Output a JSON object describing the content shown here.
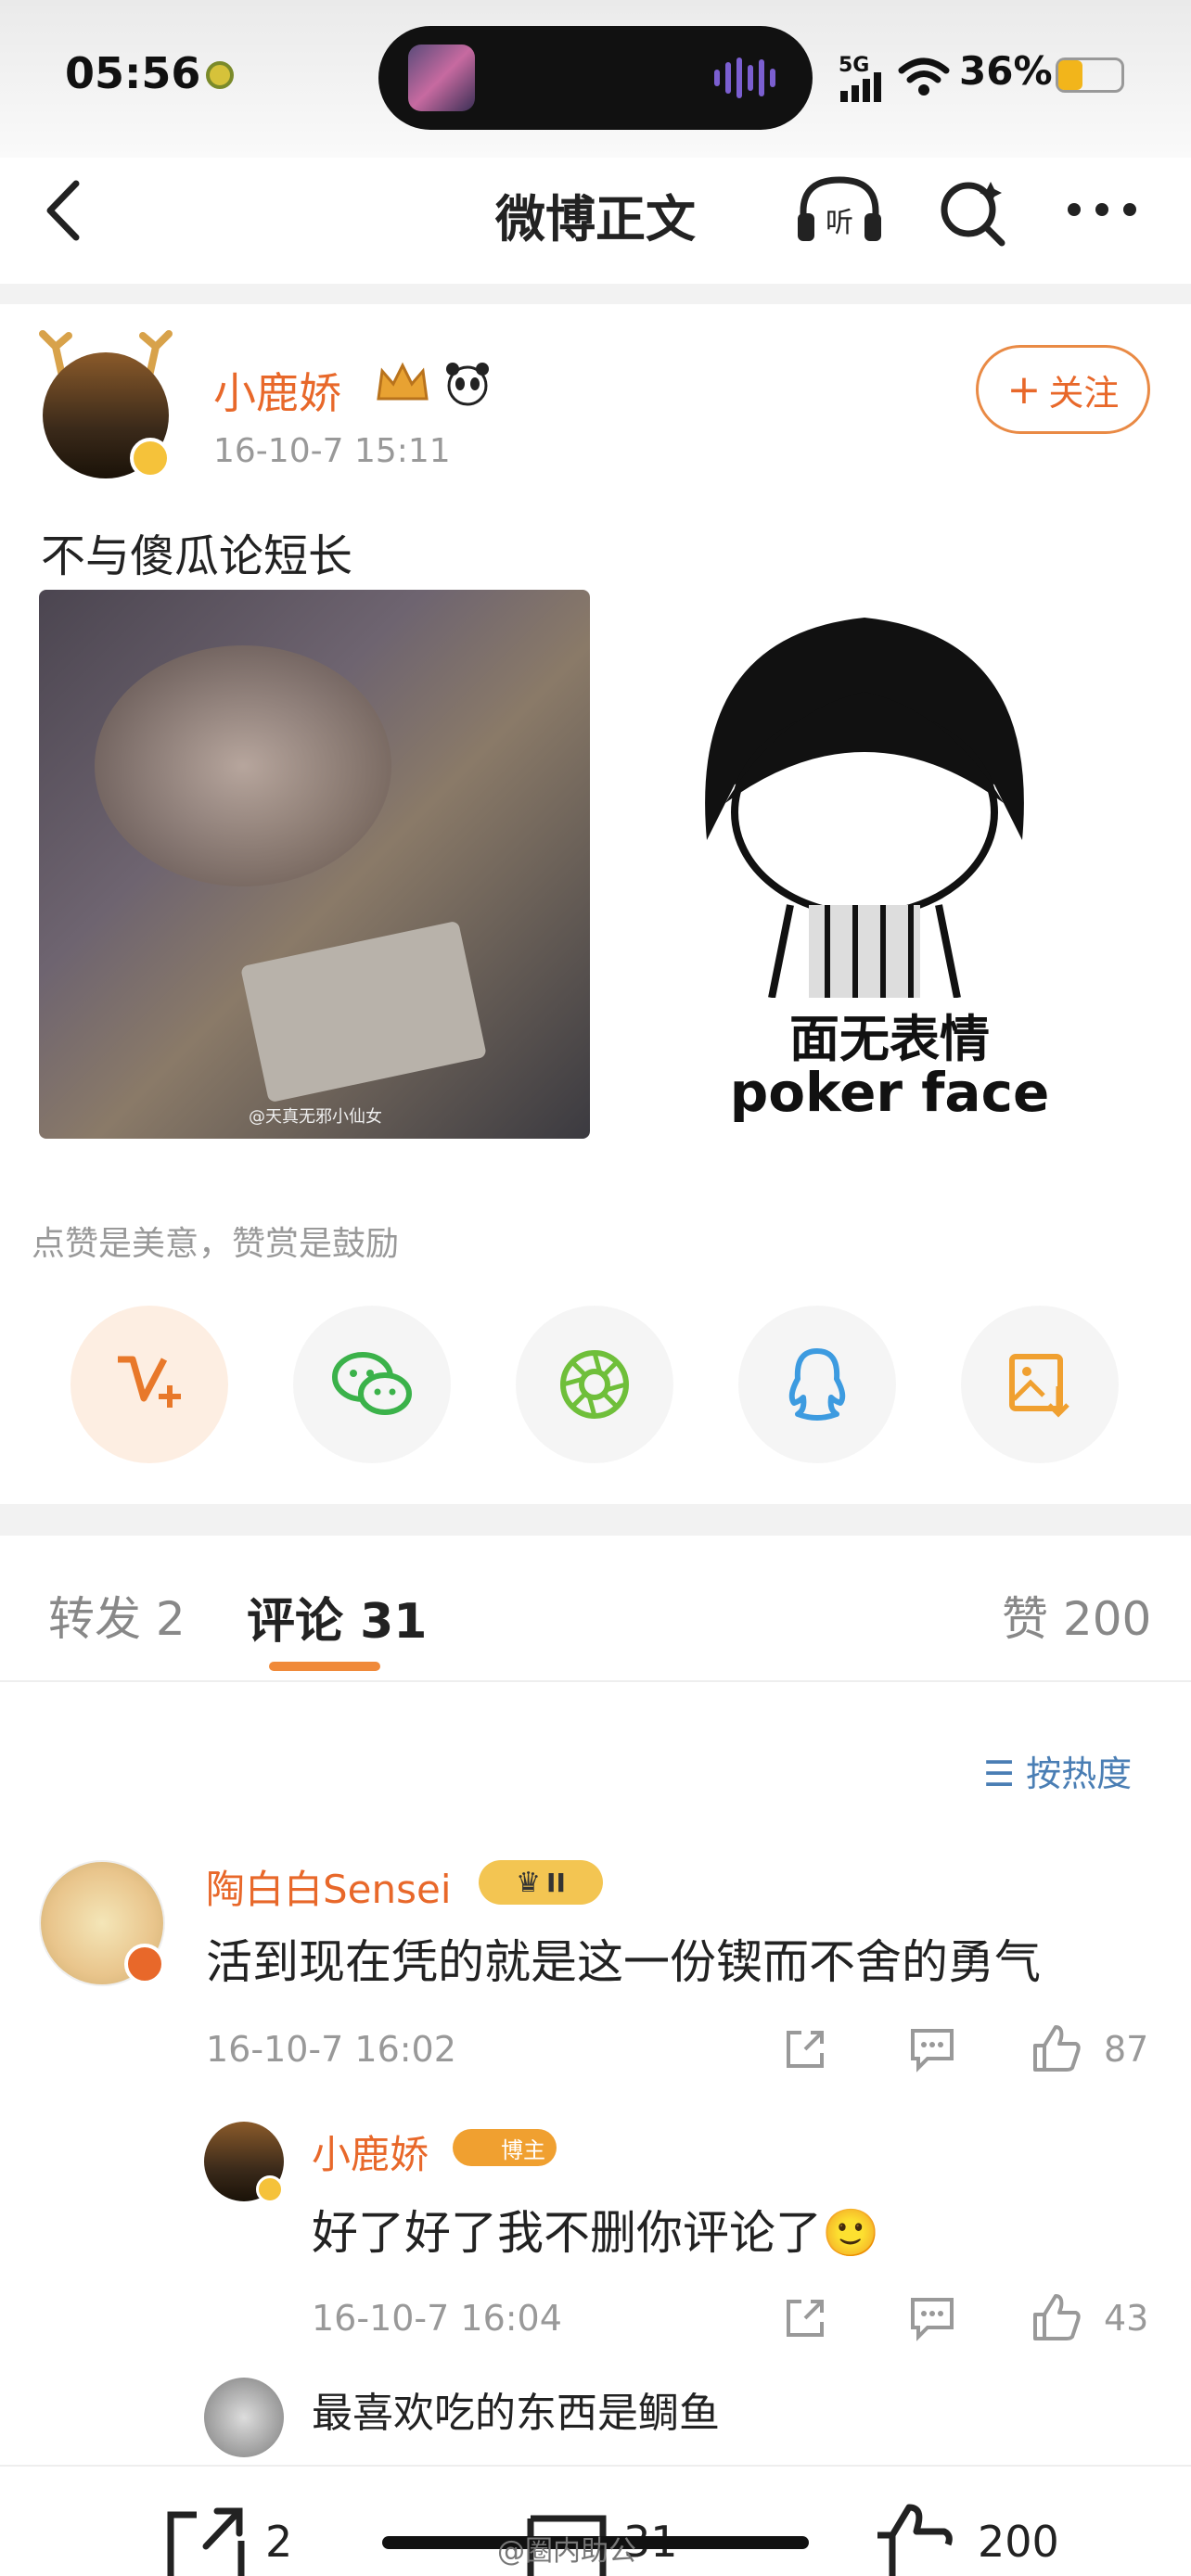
{
  "status_bar": {
    "time": "05:56",
    "network": "5G",
    "battery": "36%"
  },
  "nav": {
    "title": "微博正文"
  },
  "post": {
    "author": "小鹿娇",
    "time": "16-10-7 15:11",
    "follow_label": "关注",
    "text": "不与傻瓜论短长",
    "image1_watermark": "@天真无邪小仙女",
    "image2_caption_line1": "面无表情",
    "image2_caption_line2": "poker face"
  },
  "reward_tip": "点赞是美意，赞赏是鼓励",
  "tabs": {
    "repost": "转发 2",
    "comments": "评论 31",
    "likes": "赞 200"
  },
  "sort_label": "按热度",
  "comments": [
    {
      "author": "陶白白Sensei",
      "badge": "II",
      "text": "活到现在凭的就是这一份锲而不舍的勇气",
      "time": "16-10-7 16:02",
      "likes": "87"
    },
    {
      "author": "小鹿娇",
      "badge": "博主",
      "text": "好了好了我不删你评论了🙂",
      "time": "16-10-7 16:04",
      "likes": "43"
    },
    {
      "text": "最喜欢吃的东西是鲷鱼"
    }
  ],
  "bottom": {
    "repost_count": "2",
    "comment_count": "31",
    "like_count": "200",
    "watermark": "@圈内助公"
  },
  "colors": {
    "accent": "#e8682a",
    "link": "#4a7eb4",
    "wechat": "#3bb24a",
    "qq": "#3d9be0"
  }
}
